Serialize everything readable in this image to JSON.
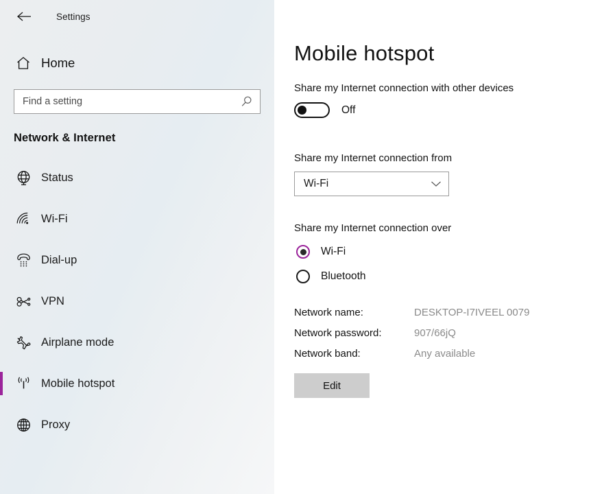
{
  "titlebar": {
    "back_icon": "back-arrow-icon",
    "app_title": "Settings"
  },
  "sidebar": {
    "home": {
      "label": "Home",
      "icon": "home-icon"
    },
    "search": {
      "placeholder": "Find a setting",
      "value": "",
      "icon": "search-icon"
    },
    "section_title": "Network & Internet",
    "accent_color": "#9b249b",
    "items": [
      {
        "label": "Status",
        "icon": "globe-icon",
        "selected": false
      },
      {
        "label": "Wi-Fi",
        "icon": "wifi-icon",
        "selected": false
      },
      {
        "label": "Dial-up",
        "icon": "dialup-phone-icon",
        "selected": false
      },
      {
        "label": "VPN",
        "icon": "vpn-key-icon",
        "selected": false
      },
      {
        "label": "Airplane mode",
        "icon": "airplane-icon",
        "selected": false
      },
      {
        "label": "Mobile hotspot",
        "icon": "hotspot-icon",
        "selected": true
      },
      {
        "label": "Proxy",
        "icon": "globe-grid-icon",
        "selected": false
      }
    ]
  },
  "main": {
    "page_title": "Mobile hotspot",
    "share_label": "Share my Internet connection with other devices",
    "toggle": {
      "state_label": "Off",
      "on": false
    },
    "share_from": {
      "label": "Share my Internet connection from",
      "selected": "Wi-Fi",
      "chevron_icon": "chevron-down-icon"
    },
    "share_over": {
      "label": "Share my Internet connection over",
      "options": [
        {
          "label": "Wi-Fi",
          "checked": true
        },
        {
          "label": "Bluetooth",
          "checked": false
        }
      ]
    },
    "details": [
      {
        "key": "Network name:",
        "value": "DESKTOP-I7IVEEL 0079"
      },
      {
        "key": "Network password:",
        "value": "907/66jQ"
      },
      {
        "key": "Network band:",
        "value": "Any available"
      }
    ],
    "edit_label": "Edit"
  }
}
